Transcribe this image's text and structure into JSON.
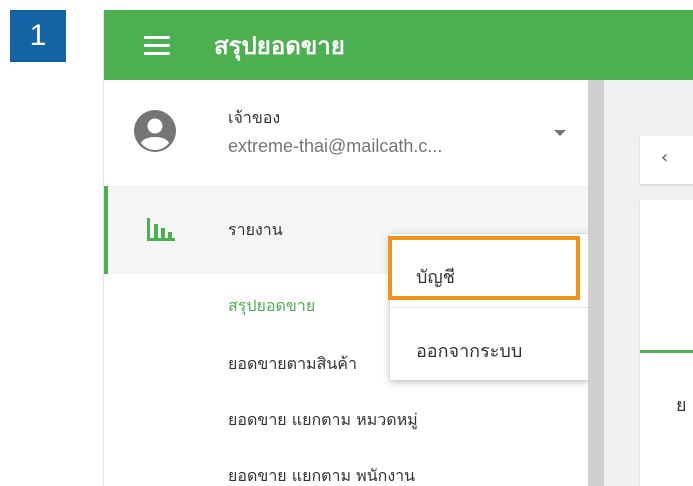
{
  "step_badge": "1",
  "topbar": {
    "menu_icon": "hamburger-menu-icon",
    "title": "สรุปยอดขาย",
    "color": "#4caf50"
  },
  "account": {
    "avatar_icon": "account-circle-icon",
    "name": "เจ้าของ",
    "email": "extreme-thai@mailcath.c...",
    "caret_icon": "dropdown-caret-icon"
  },
  "sidebar": {
    "report_label": "รายงาน",
    "report_icon": "bar-chart-icon",
    "subitems": [
      "สรุปยอดขาย",
      "ยอดขายตามสินค้า",
      "ยอดขาย แยกตาม หมวดหมู่",
      "ยอดขาย แยกตาม พนักงาน"
    ]
  },
  "dropdown": {
    "items": [
      "บัญชี",
      "ออกจากระบบ"
    ],
    "highlight_color": "#f0921e"
  },
  "content": {
    "back_glyph": "‹",
    "partial_text": "ย"
  }
}
